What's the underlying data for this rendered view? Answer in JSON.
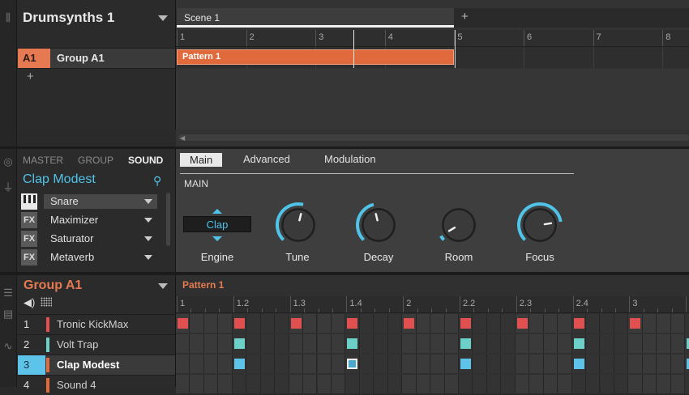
{
  "colors": {
    "accent_blue": "#4fc3e8",
    "group_orange": "#e57a52",
    "pattern_orange": "#e06a3c",
    "kick_red": "#e05050",
    "snare_teal": "#6cd0c8",
    "clap_blue": "#5ec3e8"
  },
  "group_panel": {
    "title": "Drumsynths 1",
    "row_code": "A1",
    "row_name": "Group A1",
    "add_label": "+"
  },
  "arranger": {
    "scene_tab": "Scene 1",
    "add_scene": "+",
    "ruler": [
      "1",
      "2",
      "3",
      "4",
      "5",
      "6",
      "7",
      "8"
    ],
    "pattern_label": "Pattern 1"
  },
  "sound_panel": {
    "tabs": [
      "MASTER",
      "GROUP",
      "SOUND"
    ],
    "sound_name": "Clap Modest",
    "slots": [
      {
        "icon": "piano-icon",
        "label": "Snare"
      },
      {
        "icon": "fx-icon",
        "icon_text": "FX",
        "label": "Maximizer"
      },
      {
        "icon": "fx-icon",
        "icon_text": "FX",
        "label": "Saturator"
      },
      {
        "icon": "fx-icon",
        "icon_text": "FX",
        "label": "Metaverb"
      }
    ]
  },
  "plugin": {
    "tabs": [
      "Main",
      "Advanced",
      "Modulation"
    ],
    "section": "MAIN",
    "engine": {
      "value": "Clap",
      "label": "Engine"
    },
    "knobs": [
      {
        "label": "Tune",
        "level": 0.55
      },
      {
        "label": "Decay",
        "level": 0.45
      },
      {
        "label": "Room",
        "level": 0.05
      },
      {
        "label": "Focus",
        "level": 0.8
      }
    ]
  },
  "group_list": {
    "title": "Group A1",
    "sounds": [
      {
        "num": "1",
        "name": "Tronic KickMax",
        "color": "#e05050"
      },
      {
        "num": "2",
        "name": "Volt Trap",
        "color": "#6cd0c8"
      },
      {
        "num": "3",
        "name": "Clap Modest",
        "color": "#5ec3e8"
      },
      {
        "num": "4",
        "name": "Sound 4",
        "color": "#777777"
      }
    ]
  },
  "pattern_editor": {
    "title": "Pattern 1",
    "ruler": [
      "1",
      "1.2",
      "1.3",
      "1.4",
      "2",
      "2.2",
      "2.3",
      "2.4",
      "3"
    ],
    "rows": [
      {
        "steps": [
          0,
          4,
          8,
          12,
          16,
          20,
          24,
          28,
          32
        ],
        "color": "#e05050"
      },
      {
        "steps": [
          4,
          12,
          20,
          28,
          36
        ],
        "color": "#6cd0c8"
      },
      {
        "steps": [
          4,
          12,
          20,
          28,
          36
        ],
        "color": "#5ec3e8",
        "selected_step": 12
      }
    ]
  }
}
